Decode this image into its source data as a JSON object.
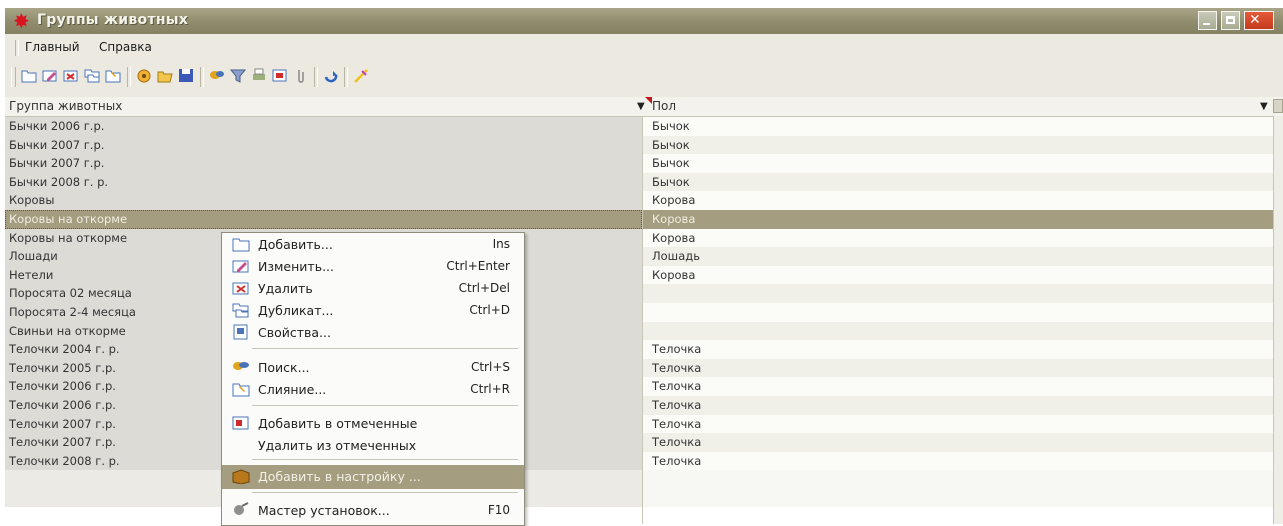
{
  "window": {
    "title": "Группы животных"
  },
  "menu": {
    "main": "Главный",
    "help": "Справка"
  },
  "toolbar": {
    "icons": [
      "folder-new-icon",
      "edit-icon",
      "delete-icon",
      "duplicate-icon",
      "merge-icon",
      "properties-icon",
      "open-icon",
      "save-icon",
      "search-icon",
      "filter-icon",
      "print-icon",
      "mark-icon",
      "attach-icon",
      "refresh-icon",
      "wizard-icon"
    ]
  },
  "grid": {
    "columns": [
      "Группа животных",
      "Пол"
    ],
    "rows": [
      {
        "group": "Бычки 2006 г.р.",
        "sex": "Бычок"
      },
      {
        "group": "Бычки 2007 г.р.",
        "sex": "Бычок"
      },
      {
        "group": "Бычки 2007 г.р.",
        "sex": "Бычок"
      },
      {
        "group": "Бычки 2008 г. р.",
        "sex": "Бычок"
      },
      {
        "group": "Коровы",
        "sex": "Корова"
      },
      {
        "group": "Коровы на откорме",
        "sex": "Корова"
      },
      {
        "group": "Коровы на откорме",
        "sex": "Корова"
      },
      {
        "group": "Лошади",
        "sex": "Лошадь"
      },
      {
        "group": "Нетели",
        "sex": "Корова"
      },
      {
        "group": "Поросята 02 месяца",
        "sex": ""
      },
      {
        "group": "Поросята 2-4 месяца",
        "sex": ""
      },
      {
        "group": "Свиньи на откорме",
        "sex": ""
      },
      {
        "group": "Телочки 2004 г. р.",
        "sex": "Телочка"
      },
      {
        "group": "Телочки 2005 г.р.",
        "sex": "Телочка"
      },
      {
        "group": "Телочки 2006 г.р.",
        "sex": "Телочка"
      },
      {
        "group": "Телочки 2006 г.р.",
        "sex": "Телочка"
      },
      {
        "group": "Телочки 2007 г.р.",
        "sex": "Телочка"
      },
      {
        "group": "Телочки 2007 г.р.",
        "sex": "Телочка"
      },
      {
        "group": "Телочки 2008 г. р.",
        "sex": "Телочка"
      }
    ],
    "selected_row": 5
  },
  "context_menu": {
    "items": [
      {
        "label": "Добавить...",
        "shortcut": "Ins",
        "icon": "folder-add-icon"
      },
      {
        "label": "Изменить...",
        "shortcut": "Ctrl+Enter",
        "icon": "edit-icon"
      },
      {
        "label": "Удалить",
        "shortcut": "Ctrl+Del",
        "icon": "delete-icon"
      },
      {
        "label": "Дубликат...",
        "shortcut": "Ctrl+D",
        "icon": "duplicate-icon"
      },
      {
        "label": "Свойства...",
        "shortcut": "",
        "icon": "properties-icon"
      },
      {
        "label": "Поиск...",
        "shortcut": "Ctrl+S",
        "icon": "search-icon"
      },
      {
        "label": "Слияние...",
        "shortcut": "Ctrl+R",
        "icon": "merge-icon"
      },
      {
        "label": "Добавить в отмеченные",
        "shortcut": "",
        "icon": "mark-icon"
      },
      {
        "label": "Удалить из отмеченных",
        "shortcut": "",
        "icon": ""
      },
      {
        "label": "Добавить в настройку ...",
        "shortcut": "",
        "icon": "settings-add-icon"
      },
      {
        "label": "Мастер установок...",
        "shortcut": "F10",
        "icon": "wizard-icon"
      }
    ]
  }
}
